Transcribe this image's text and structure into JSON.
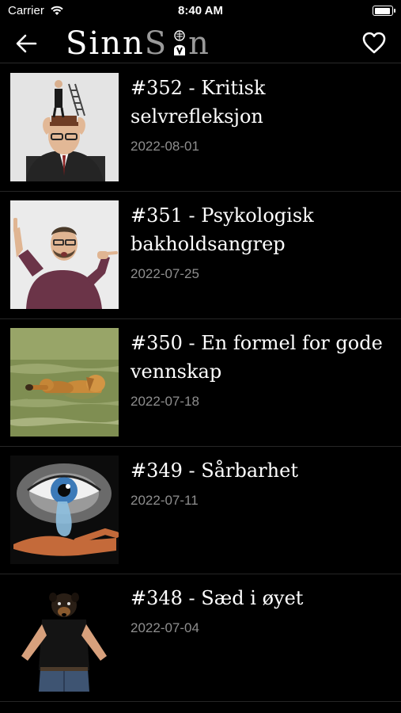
{
  "status": {
    "carrier": "Carrier",
    "time": "8:40 AM"
  },
  "nav": {
    "logo_part1": "Sinn",
    "logo_part2": "S",
    "logo_part3": "n"
  },
  "episodes": [
    {
      "title": "#352 - Kritisk selvrefleksjon",
      "date": "2022-08-01"
    },
    {
      "title": "#351 - Psykologisk bakholdsangrep",
      "date": "2022-07-25"
    },
    {
      "title": "#350 - En formel for gode vennskap",
      "date": "2022-07-18"
    },
    {
      "title": "#349 - Sårbarhet",
      "date": "2022-07-11"
    },
    {
      "title": "#348 - Sæd i øyet",
      "date": "2022-07-04"
    }
  ],
  "colors": {
    "background": "#000000",
    "title": "#ffffff",
    "date": "#8e8e8e"
  },
  "icons": [
    "wifi-icon",
    "battery-icon",
    "back-arrow-icon",
    "heart-icon"
  ]
}
